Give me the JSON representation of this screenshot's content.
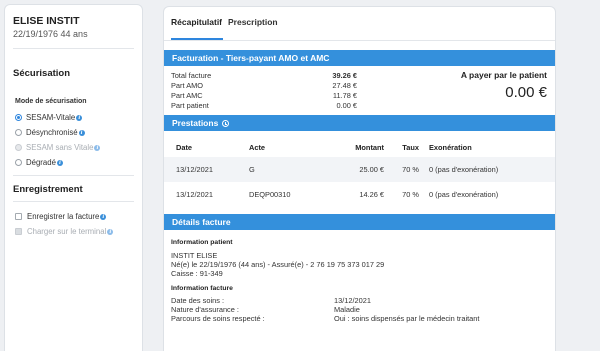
{
  "patient": {
    "name": "ELISE INSTIT",
    "info": "22/19/1976 44 ans"
  },
  "securisation": {
    "title": "Sécurisation",
    "mode_label": "Mode de sécurisation",
    "options": [
      {
        "label": "SESAM-Vitale",
        "selected": true,
        "disabled": false
      },
      {
        "label": "Désynchronisé",
        "selected": false,
        "disabled": false
      },
      {
        "label": "SESAM sans Vitale",
        "selected": false,
        "disabled": true
      },
      {
        "label": "Dégradé",
        "selected": false,
        "disabled": false
      }
    ]
  },
  "enregistrement": {
    "title": "Enregistrement",
    "options": [
      {
        "label": "Enregistrer la facture",
        "disabled": false
      },
      {
        "label": "Charger sur le terminal",
        "disabled": true
      }
    ]
  },
  "tabs": [
    {
      "label": "Récapitulatif",
      "active": true
    },
    {
      "label": "Prescription",
      "active": false
    }
  ],
  "facturation": {
    "title": "Facturation - Tiers-payant AMO et AMC",
    "rows": [
      {
        "label": "Total facture",
        "amount": "39.26 €"
      },
      {
        "label": "Part AMO",
        "amount": "27.48 €"
      },
      {
        "label": "Part AMC",
        "amount": "11.78 €"
      },
      {
        "label": "Part patient",
        "amount": "0.00 €"
      }
    ],
    "pay_label": "A payer par le patient",
    "pay_amount": "0.00 €"
  },
  "prestations": {
    "title": "Prestations",
    "columns": [
      "Date",
      "Acte",
      "Montant",
      "Taux",
      "Exonération"
    ],
    "rows": [
      [
        "13/12/2021",
        "G",
        "25.00 €",
        "70 %",
        "0 (pas d'exonération)"
      ],
      [
        "13/12/2021",
        "DEQP00310",
        "14.26 €",
        "70 %",
        "0 (pas d'exonération)"
      ]
    ]
  },
  "details": {
    "title": "Détails facture",
    "patient_label": "Information patient",
    "patient_lines": [
      "INSTIT ELISE",
      "Né(e) le 22/19/1976 (44 ans) - Assuré(e) - 2 76 19 75 373 017 29",
      "Caisse : 91-349"
    ],
    "facture_label": "Information facture",
    "facture_rows": [
      {
        "label": "Date des soins :",
        "value": "13/12/2021"
      },
      {
        "label": "Nature d'assurance :",
        "value": "Maladie"
      },
      {
        "label": "Parcours de soins respecté :",
        "value": "Oui : soins dispensés par le médecin traitant"
      }
    ]
  },
  "colors": {
    "accent": "#3490dc",
    "info_icon": "#3a8fd9",
    "background": "#eef0f3"
  }
}
